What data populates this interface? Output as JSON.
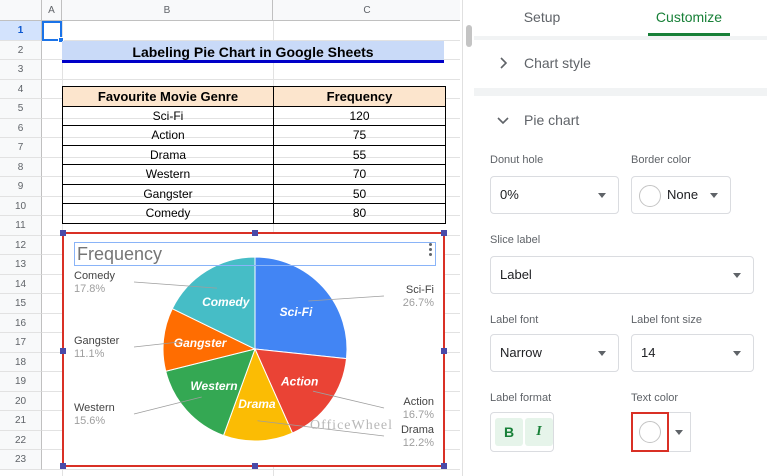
{
  "sheet": {
    "columns": [
      "A",
      "B",
      "C"
    ],
    "rows": [
      "1",
      "2",
      "3",
      "4",
      "5",
      "6",
      "7",
      "8",
      "9",
      "10",
      "11",
      "12",
      "13",
      "14",
      "15",
      "16",
      "17",
      "18",
      "19",
      "20",
      "21",
      "22",
      "23"
    ],
    "title": "Labeling Pie Chart in Google Sheets",
    "table": {
      "headers": [
        "Favourite Movie Genre",
        "Frequency"
      ],
      "rows": [
        {
          "genre": "Sci-Fi",
          "freq": "120"
        },
        {
          "genre": "Action",
          "freq": "75"
        },
        {
          "genre": "Drama",
          "freq": "55"
        },
        {
          "genre": "Western",
          "freq": "70"
        },
        {
          "genre": "Gangster",
          "freq": "50"
        },
        {
          "genre": "Comedy",
          "freq": "80"
        }
      ]
    },
    "watermark": "OfficeWheel"
  },
  "chart_data": {
    "type": "pie",
    "title": "Frequency",
    "categories": [
      "Sci-Fi",
      "Action",
      "Drama",
      "Western",
      "Gangster",
      "Comedy"
    ],
    "values": [
      120,
      75,
      55,
      70,
      50,
      80
    ],
    "percentages": [
      "26.7%",
      "16.7%",
      "12.2%",
      "15.6%",
      "11.1%",
      "17.8%"
    ],
    "colors": [
      "#4285f4",
      "#ea4335",
      "#fbbc04",
      "#34a853",
      "#ff6d01",
      "#46bdc6"
    ]
  },
  "panel": {
    "tabs": [
      "Setup",
      "Customize"
    ],
    "active_tab": "Customize",
    "sections": {
      "chart_style": "Chart style",
      "pie_chart": "Pie chart"
    },
    "fields": {
      "donut_hole": {
        "label": "Donut hole",
        "value": "0%"
      },
      "border_color": {
        "label": "Border color",
        "value": "None"
      },
      "slice_label": {
        "label": "Slice label",
        "value": "Label"
      },
      "label_font": {
        "label": "Label font",
        "value": "Narrow"
      },
      "label_font_size": {
        "label": "Label font size",
        "value": "14"
      },
      "label_format": {
        "label": "Label format",
        "bold": "B",
        "italic": "I"
      },
      "text_color": {
        "label": "Text color"
      }
    }
  }
}
